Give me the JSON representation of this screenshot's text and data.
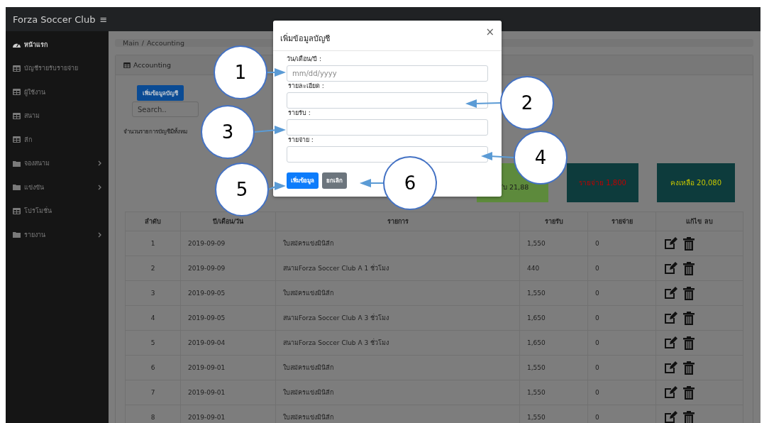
{
  "brand": {
    "title": "Forza Soccer Club",
    "menu_glyph": "≡"
  },
  "sidebar": {
    "items": [
      {
        "label": "หน้าแรก",
        "kind": "dashboard",
        "selected": true
      },
      {
        "label": "บัญชีรายรับรายจ่าย",
        "kind": "table",
        "selected": false
      },
      {
        "label": "ผู้ใช้งาน",
        "kind": "table",
        "selected": false
      },
      {
        "label": "สนาม",
        "kind": "table",
        "selected": false
      },
      {
        "label": "ลีก",
        "kind": "table",
        "selected": false
      },
      {
        "label": "จองสนาม",
        "kind": "folder",
        "selected": false
      },
      {
        "label": "แข่งขัน",
        "kind": "folder",
        "selected": false
      },
      {
        "label": "โปรโมชั่น",
        "kind": "table",
        "selected": false
      },
      {
        "label": "รายงาน",
        "kind": "folder",
        "selected": false
      }
    ]
  },
  "breadcrumb": [
    "Main",
    "Accounting"
  ],
  "breadcrumb_separator": "/",
  "card": {
    "title": "Accounting",
    "add_button": "เพิ่มข้อมูลบัญชี",
    "search": {
      "placeholder": "Search.."
    },
    "count_text": "จำนวนรายการบัญชีมีทั้งหม",
    "summaries": [
      {
        "text": "ับ 21,88",
        "color": "#1a1a1a"
      },
      {
        "text": "รายจ่าย 1,800",
        "color": "#c00000"
      },
      {
        "text": "คงเหลือ 20,080",
        "color": "#c8c800"
      }
    ]
  },
  "table": {
    "columns": [
      "ลำดับ",
      "ปี/เดือน/วัน",
      "รายการ",
      "รายรับ",
      "รายจ่าย",
      "แก้ไข ลบ"
    ],
    "rows": [
      [
        "1",
        "2019-09-09",
        "ใบสมัครแข่งมินิลีก",
        "1,550",
        "0"
      ],
      [
        "2",
        "2019-09-09",
        "สนามForza Soccer Club A 1 ชั่วโมง",
        "440",
        "0"
      ],
      [
        "3",
        "2019-09-05",
        "ใบสมัครแข่งมินิลีก",
        "1,550",
        "0"
      ],
      [
        "4",
        "2019-09-05",
        "สนามForza Soccer Club A 3 ชั่วโมง",
        "1,650",
        "0"
      ],
      [
        "5",
        "2019-09-04",
        "สนามForza Soccer Club A 3 ชั่วโมง",
        "1,650",
        "0"
      ],
      [
        "6",
        "2019-09-01",
        "ใบสมัครแข่งมินิลีก",
        "1,550",
        "0"
      ],
      [
        "7",
        "2019-09-01",
        "ใบสมัครแข่งมินิลีก",
        "1,550",
        "0"
      ],
      [
        "8",
        "2019-09-01",
        "ใบสมัครแข่งมินิลีก",
        "1,550",
        "0"
      ]
    ]
  },
  "modal": {
    "title": "เพิ่มข้อมูลบัญชี",
    "close": "×",
    "fields": [
      {
        "label": "วัน/เดือน/ปี :",
        "placeholder": "mm/dd/yyyy"
      },
      {
        "label": "รายละเอียด :"
      },
      {
        "label": "รายรับ :"
      },
      {
        "label": "รายจ่าย :"
      }
    ],
    "submit": "เพิ่มข้อมูล",
    "cancel": "ยกเลิก"
  },
  "callouts": [
    "1",
    "2",
    "3",
    "4",
    "5",
    "6"
  ]
}
